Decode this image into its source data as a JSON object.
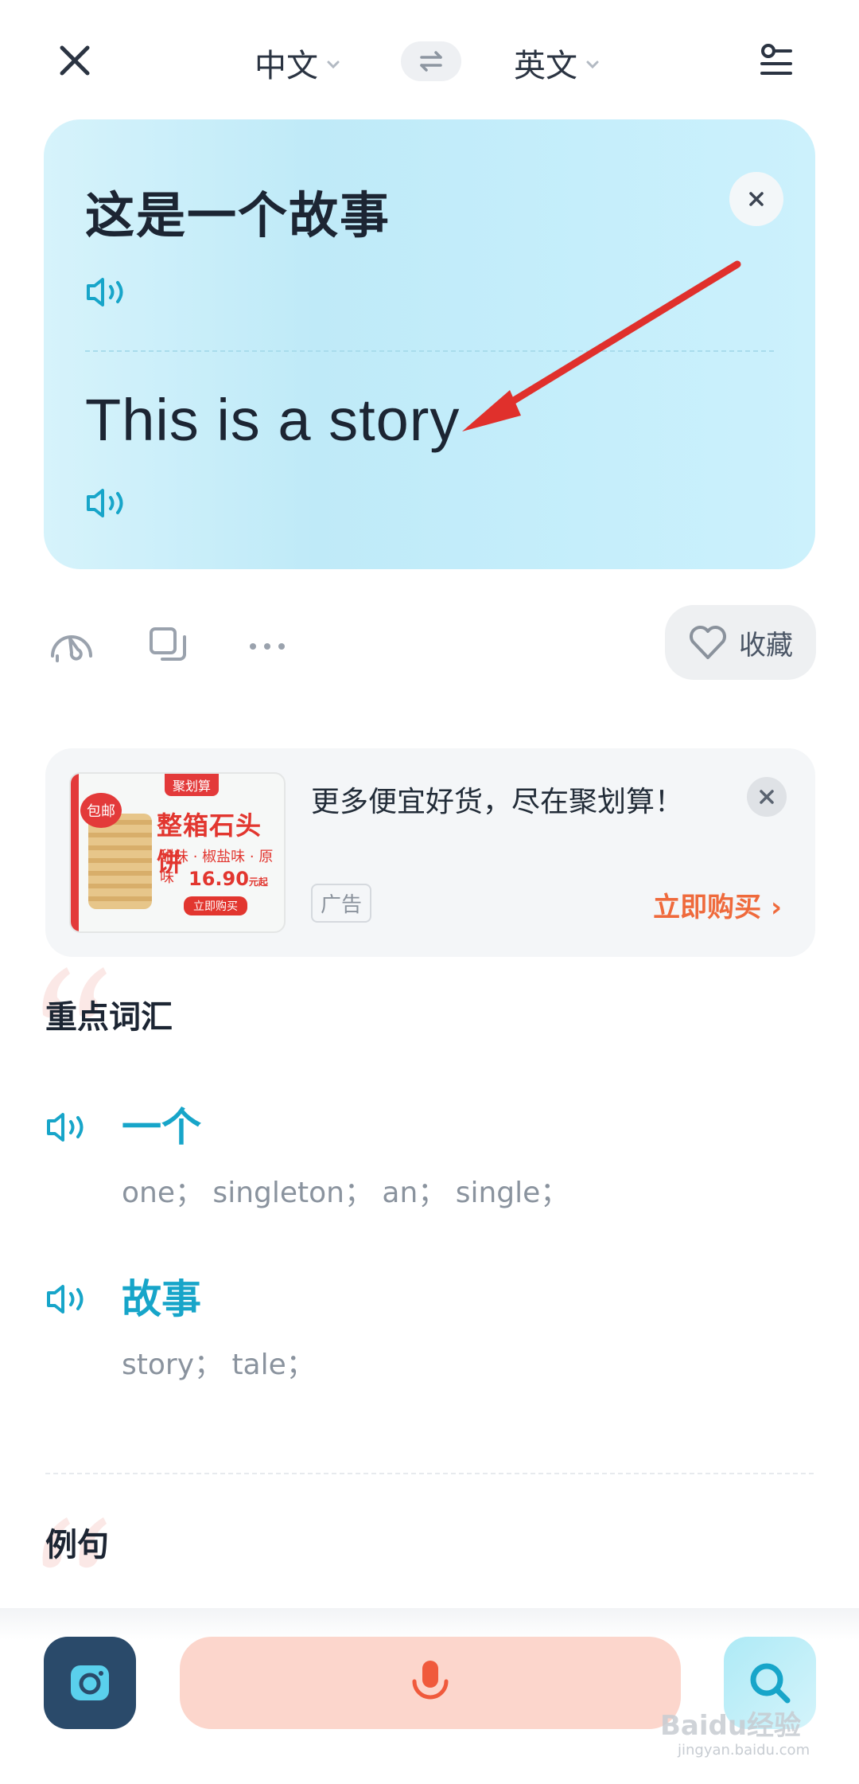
{
  "header": {
    "source_lang": "中文",
    "target_lang": "英文"
  },
  "translation": {
    "source_text": "这是一个故事",
    "target_text": "This is a story"
  },
  "actions": {
    "favorite_label": "收藏"
  },
  "ad": {
    "image": {
      "badge": "聚划算",
      "bag_label": "包邮",
      "title": "整箱石头饼",
      "flavors": "甜味 · 椒盐味 · 原味",
      "price": "16.90",
      "price_unit": "元起",
      "buy_label": "立即购买"
    },
    "text": "更多便宜好货，尽在聚划算！",
    "tag": "广告",
    "cta": "立即购买 ›"
  },
  "vocabulary": {
    "title": "重点词汇",
    "words": [
      {
        "term": "一个",
        "definitions": "one；  singleton；  an；  single；"
      },
      {
        "term": "故事",
        "definitions": "story；  tale；"
      }
    ]
  },
  "examples": {
    "title": "例句"
  },
  "watermark": {
    "text": "Baidu经验",
    "sub": "jingyan.baidu.com"
  },
  "colors": {
    "accent": "#17a5c9",
    "card_bg": "#c5eefb",
    "cta": "#ef6a3c",
    "mic_bg": "#fcd6cc",
    "arrow": "#e0302c"
  }
}
